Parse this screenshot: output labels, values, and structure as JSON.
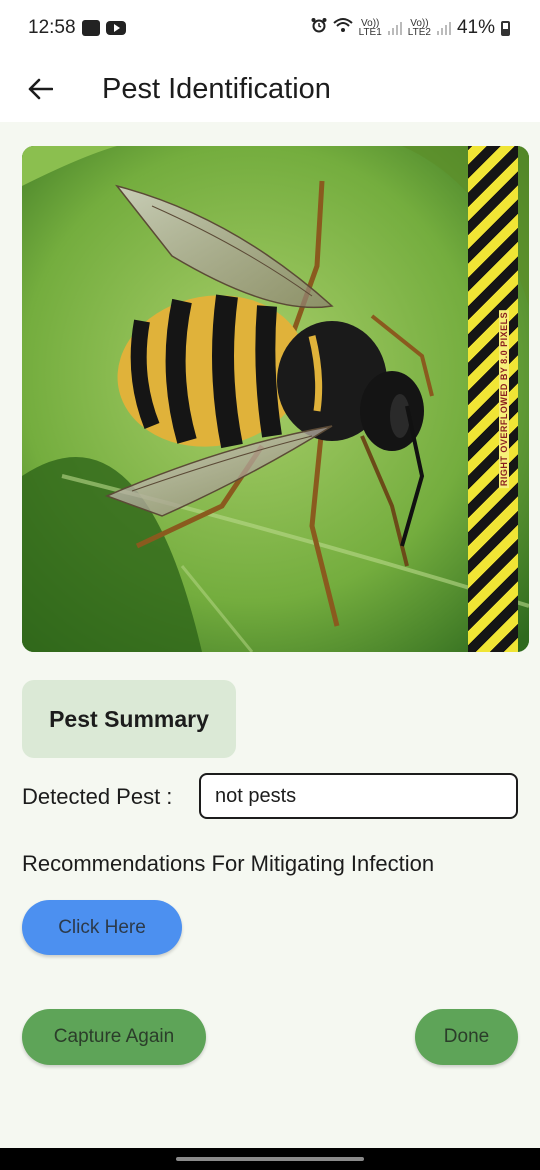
{
  "status_bar": {
    "time": "12:58",
    "battery": "41%",
    "sim1": "LTE1",
    "sim2": "LTE2",
    "volte": "Vo))",
    "icons": [
      "gallery-icon",
      "youtube-icon",
      "alarm-icon",
      "wifi-icon",
      "signal-icon",
      "battery-icon"
    ]
  },
  "app_bar": {
    "title": "Pest Identification",
    "back_icon": "arrow-left-icon"
  },
  "image": {
    "subject": "wasp-on-leaf",
    "overflow_warning": "RIGHT OVERFLOWED BY 8.0 PIXELS"
  },
  "summary": {
    "title": "Pest Summary"
  },
  "detected": {
    "label": "Detected Pest :",
    "value": "not pests"
  },
  "recommendations": {
    "label": "Recommendations For Mitigating Infection",
    "button": "Click Here"
  },
  "actions": {
    "capture_again": "Capture Again",
    "done": "Done"
  },
  "colors": {
    "background": "#f5f8f1",
    "summary_card": "#dbe9d6",
    "click_button": "#4c90f0",
    "action_button": "#5ea458"
  }
}
